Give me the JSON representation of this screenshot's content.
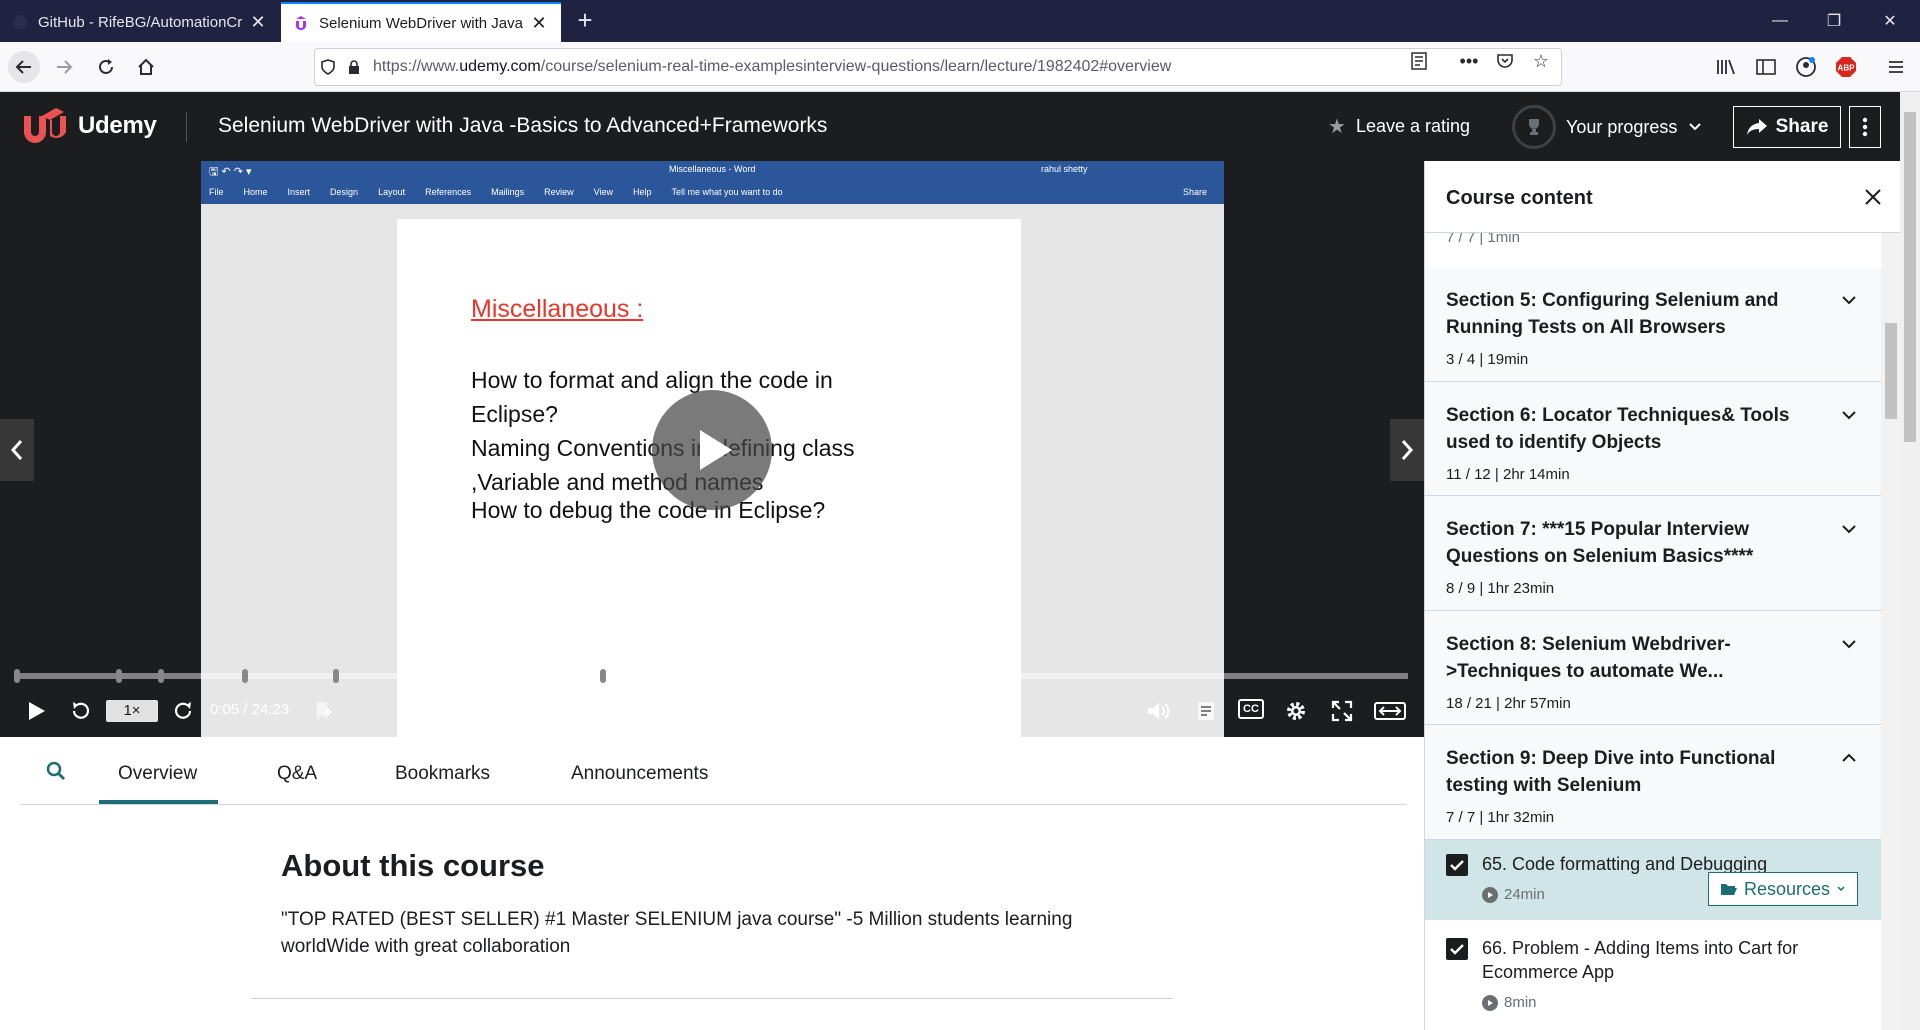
{
  "browser": {
    "tabs": [
      {
        "label": "GitHub - RifeBG/AutomationCr",
        "active": false
      },
      {
        "label": "Selenium WebDriver with Java",
        "active": true
      }
    ],
    "url_prefix": "https://www.",
    "url_host": "udemy.com",
    "url_path": "/course/selenium-real-time-examplesinterview-questions/learn/lecture/1982402#overview",
    "abp_badge": "ABP"
  },
  "header": {
    "brand": "Udemy",
    "course_title": "Selenium WebDriver with Java -Basics to Advanced+Frameworks",
    "leave_rating": "Leave a rating",
    "your_progress": "Your progress",
    "share": "Share"
  },
  "video": {
    "word_doc_title": "Miscellaneous  -  Word",
    "word_user": "rahul shetty",
    "word_menu": [
      "File",
      "Home",
      "Insert",
      "Design",
      "Layout",
      "References",
      "Mailings",
      "Review",
      "View",
      "Help",
      "Tell me what you want to do"
    ],
    "word_share": "Share",
    "slide_heading": "Miscellaneous :",
    "slide_lines": [
      "How to format and align the code in Eclipse?",
      "Naming Conventions in defining class ,Variable and method names",
      "How to debug the code in Eclipse?"
    ],
    "speed": "1×",
    "time": "0:05 / 24:23",
    "cc": "CC",
    "progress_fraction": 0.004
  },
  "tabs": {
    "items": [
      "Overview",
      "Q&A",
      "Bookmarks",
      "Announcements"
    ],
    "active": "Overview"
  },
  "about": {
    "title": "About this course",
    "text": "\"TOP RATED (BEST SELLER) #1 Master SELENIUM java course\" -5 Million students learning worldWide with great collaboration"
  },
  "sidebar": {
    "title": "Course content",
    "cut_meta": "7 / 7  |  1min",
    "sections": [
      {
        "title": "Section 5: Configuring Selenium and Running Tests on All Browsers",
        "meta": "3 / 4  |  19min",
        "expanded": false
      },
      {
        "title": "Section 6: Locator Techniques& Tools used to identify Objects",
        "meta": "11 / 12  |  2hr 14min",
        "expanded": false
      },
      {
        "title": "Section 7: ***15 Popular Interview Questions on Selenium Basics****",
        "meta": "8 / 9  |  1hr 23min",
        "expanded": false
      },
      {
        "title": "Section 8: Selenium Webdriver->Techniques to automate We...",
        "meta": "18 / 21  |  2hr 57min",
        "expanded": false
      },
      {
        "title": "Section 9: Deep Dive into Functional testing with Selenium",
        "meta": "7 / 7  |  1hr 32min",
        "expanded": true
      }
    ],
    "items": [
      {
        "title": "65. Code formatting and Debugging",
        "duration": "24min",
        "checked": true,
        "current": true,
        "resources": "Resources"
      },
      {
        "title": "66. Problem - Adding Items into Cart for Ecommerce App",
        "duration": "8min",
        "checked": true,
        "current": false
      }
    ]
  }
}
